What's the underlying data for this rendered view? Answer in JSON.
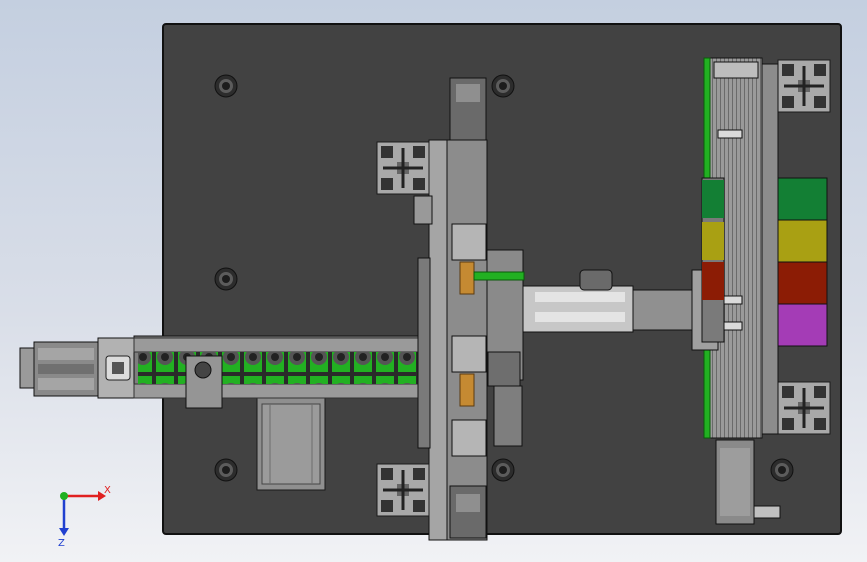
{
  "view_triad": {
    "x_label": "X",
    "z_label": "Z",
    "x_color": "#e02020",
    "y_color": "#20b020",
    "z_color": "#2040d0"
  },
  "colors": {
    "base_plate": "#424242",
    "frame_gray": "#8c8c8c",
    "belt_green": "#22b022",
    "bin_green": "#137f34",
    "bin_yellow": "#a9a013",
    "bin_red": "#8c1c05",
    "bin_purple": "#a43cb6"
  },
  "sorting_bins": [
    "green",
    "yellow",
    "red",
    "purple"
  ]
}
